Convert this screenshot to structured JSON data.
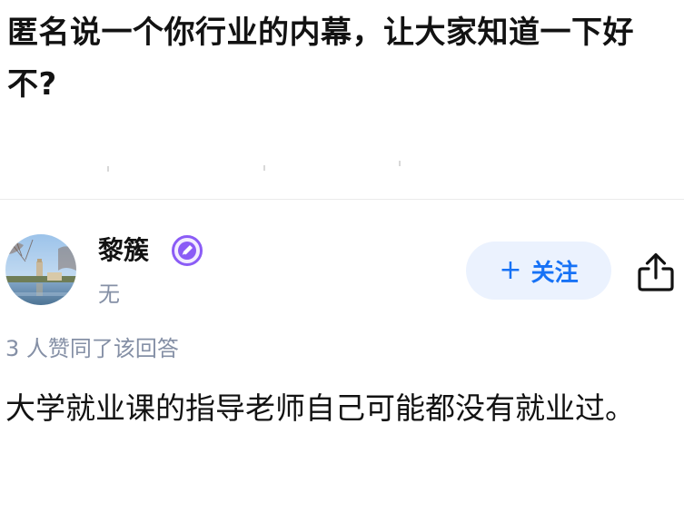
{
  "question": {
    "title": "匿名说一个你行业的内幕，让大家知道一下好不?"
  },
  "author": {
    "name": "黎簇",
    "bio": "无",
    "badge_icon": "pen-badge-icon",
    "avatar_icon": "campus-photo-avatar"
  },
  "follow_button": {
    "plus": "+",
    "label": "关注"
  },
  "share_icon": "share-icon",
  "answer": {
    "vote_text": "3 人赞同了该回答",
    "content": "大学就业课的指导老师自己可能都没有就业过。"
  },
  "colors": {
    "accent": "#1772f6",
    "follow_bg": "#ebf2fe",
    "badge": "#8b5cf6",
    "secondary_text": "#8590a6",
    "primary_text": "#121212"
  }
}
